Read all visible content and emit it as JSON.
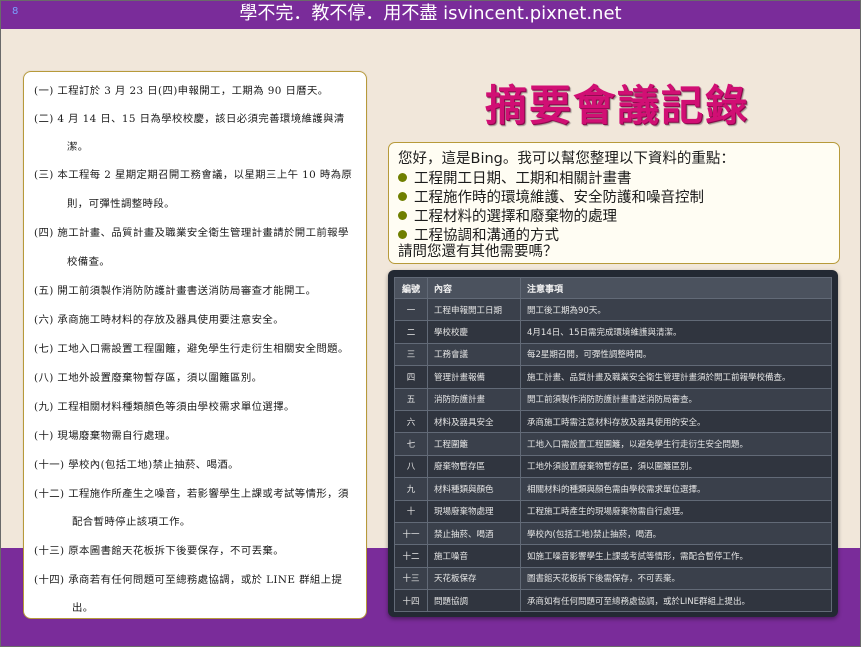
{
  "header": {
    "slide_number": "8",
    "title": "學不完．教不停．用不盡 isvincent.pixnet.net"
  },
  "document": {
    "lines": [
      "(一) 工程訂於 3 月 23 日(四)申報開工，工期為 90 日曆天。",
      "(二) 4 月 14 日、15 日為學校校慶，該日必須完善環境維護與清",
      "潔。",
      "(三) 本工程每 2 星期定期召開工務會議，以星期三上午 10 時為原",
      "則，可彈性調整時段。",
      "(四) 施工計畫、品質計畫及職業安全衛生管理計畫請於開工前報學",
      "校備查。",
      "(五) 開工前須製作消防防護計畫書送消防局審查才能開工。",
      "(六) 承商施工時材料的存放及器具使用要注意安全。",
      "(七) 工地入口需設置工程圍籬，避免學生行走衍生相關安全問題。",
      "(八) 工地外設置廢棄物暫存區，須以圍籬區別。",
      "(九) 工程相關材料種類顏色等須由學校需求單位選擇。",
      "(十) 現場廢棄物需自行處理。",
      "(十一) 學校內(包括工地)禁止抽菸、喝酒。",
      "(十二) 工程施作所產生之噪音，若影響學生上課或考試等情形，須",
      "配合暫時停止該項工作。",
      "(十三) 原本圖書館天花板拆下後要保存，不可丟棄。",
      "(十四) 承商若有任何問題可至總務處協調，或於 LINE 群組上提",
      "出。"
    ]
  },
  "main": {
    "title": "摘要會議記錄",
    "summary": {
      "intro": "您好，這是Bing。我可以幫您整理以下資料的重點：",
      "bullets": [
        "工程開工日期、工期和相關計畫書",
        "工程施作時的環境維護、安全防護和噪音控制",
        "工程材料的選擇和廢棄物的處理",
        "工程協調和溝通的方式"
      ],
      "outro": "請問您還有其他需要嗎？"
    },
    "table": {
      "headers": [
        "編號",
        "內容",
        "注意事項"
      ],
      "rows": [
        [
          "一",
          "工程申報開工日期",
          "開工後工期為90天。"
        ],
        [
          "二",
          "學校校慶",
          "4月14日、15日需完成環境維護與清潔。"
        ],
        [
          "三",
          "工務會議",
          "每2星期召開，可彈性調整時間。"
        ],
        [
          "四",
          "管理計畫報備",
          "施工計畫、品質計畫及職業安全衛生管理計畫須於開工前報學校備查。"
        ],
        [
          "五",
          "消防防護計畫",
          "開工前須製作消防防護計畫書送消防局審查。"
        ],
        [
          "六",
          "材料及器具安全",
          "承商施工時需注意材料存放及器具使用的安全。"
        ],
        [
          "七",
          "工程圍籬",
          "工地入口需設置工程圍籬，以避免學生行走衍生安全問題。"
        ],
        [
          "八",
          "廢棄物暫存區",
          "工地外須設置廢棄物暫存區，須以圍籬區別。"
        ],
        [
          "九",
          "材料種類與顏色",
          "相關材料的種類與顏色需由學校需求單位選擇。"
        ],
        [
          "十",
          "現場廢棄物處理",
          "工程施工時產生的現場廢棄物需自行處理。"
        ],
        [
          "十一",
          "禁止抽菸、喝酒",
          "學校內(包括工地)禁止抽菸，喝酒。"
        ],
        [
          "十二",
          "施工噪音",
          "如施工噪音影響學生上課或考試等情形，需配合暫停工作。"
        ],
        [
          "十三",
          "天花板保存",
          "圖書館天花板拆下後需保存，不可丟棄。"
        ],
        [
          "十四",
          "問題協調",
          "承商如有任何問題可至總務處協調，或於LINE群組上提出。"
        ]
      ]
    }
  },
  "colors": {
    "header_bg": "#7a2c9a",
    "page_bg": "#f1e7da",
    "title_color": "#d10f74",
    "bullet_color": "#6f7f00",
    "table_bg": "#232933"
  }
}
